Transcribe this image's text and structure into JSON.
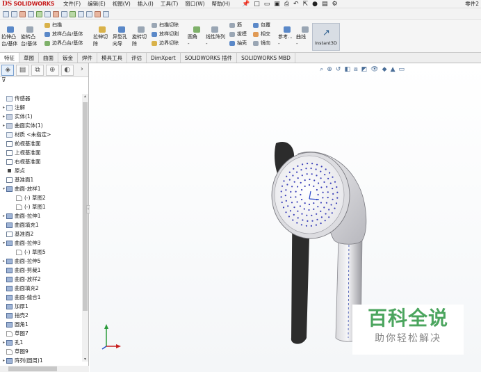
{
  "app": {
    "brand_prefix": "DS",
    "brand": "SOLIDWORKS",
    "document": "零件2"
  },
  "menu": [
    "文件(F)",
    "编辑(E)",
    "视图(V)",
    "插入(I)",
    "工具(T)",
    "窗口(W)",
    "帮助(H)"
  ],
  "ribbon": {
    "row1": [
      {
        "label": "扫描",
        "icon": "sweep-boss-icon"
      },
      {
        "label": "放样凸台/基体",
        "icon": "loft-boss-icon"
      },
      {
        "label": "边界凸台/基体",
        "icon": "boundary-boss-icon"
      },
      {
        "label": "扫描切除",
        "icon": "swept-cut-icon"
      },
      {
        "label": "放样切割",
        "icon": "lofted-cut-icon"
      },
      {
        "label": "边界切除",
        "icon": "boundary-cut-icon"
      },
      {
        "label": "筋",
        "icon": "rib-icon"
      },
      {
        "label": "包覆",
        "icon": "wrap-icon"
      },
      {
        "label": "拔模",
        "icon": "draft-icon"
      },
      {
        "label": "相交",
        "icon": "intersect-icon"
      },
      {
        "label": "抽壳",
        "icon": "shell-icon"
      },
      {
        "label": "镜向",
        "icon": "mirror-icon"
      }
    ],
    "big": [
      {
        "label1": "拉伸凸",
        "label2": "台/基体",
        "icon": "extrude-boss-icon"
      },
      {
        "label1": "旋转凸",
        "label2": "台/基体",
        "icon": "revolve-boss-icon"
      },
      {
        "label1": "拉伸切",
        "label2": "除",
        "icon": "extrude-cut-icon"
      },
      {
        "label1": "异型孔",
        "label2": "向导",
        "icon": "hole-wizard-icon"
      },
      {
        "label1": "旋转切",
        "label2": "除",
        "icon": "revolve-cut-icon"
      },
      {
        "label1": "圆角",
        "label2": "-",
        "icon": "fillet-icon"
      },
      {
        "label1": "线性阵列",
        "label2": "-",
        "icon": "linear-pattern-icon"
      },
      {
        "label1": "参考...",
        "label2": "-",
        "icon": "reference-geometry-icon"
      },
      {
        "label1": "曲线",
        "label2": "-",
        "icon": "curves-icon"
      }
    ],
    "instant3d": "Instant3D"
  },
  "tabs": [
    "特征",
    "草图",
    "曲面",
    "钣金",
    "焊件",
    "模具工具",
    "评估",
    "DimXpert",
    "SOLIDWORKS 插件",
    "SOLIDWORKS MBD"
  ],
  "active_tab": 0,
  "tree": [
    {
      "label": "传感器",
      "icon": "sensor-icon",
      "indent": 0,
      "arrow": ""
    },
    {
      "label": "注解",
      "icon": "annotations-icon",
      "indent": 0,
      "arrow": "▸"
    },
    {
      "label": "实体(1)",
      "icon": "solid-bodies-icon",
      "indent": 0,
      "arrow": "▸"
    },
    {
      "label": "曲面实体(1)",
      "icon": "surface-bodies-icon",
      "indent": 0,
      "arrow": "▸"
    },
    {
      "label": "材质 <未指定>",
      "icon": "material-icon",
      "indent": 0,
      "arrow": ""
    },
    {
      "label": "前视基准面",
      "icon": "plane-icon",
      "indent": 0,
      "arrow": ""
    },
    {
      "label": "上视基准面",
      "icon": "plane-icon",
      "indent": 0,
      "arrow": ""
    },
    {
      "label": "右视基准面",
      "icon": "plane-icon",
      "indent": 0,
      "arrow": ""
    },
    {
      "label": "原点",
      "icon": "origin-icon",
      "indent": 0,
      "arrow": ""
    },
    {
      "label": "基准面1",
      "icon": "plane-icon",
      "indent": 0,
      "arrow": ""
    },
    {
      "label": "曲面-放样1",
      "icon": "surface-loft-icon",
      "indent": 0,
      "arrow": "▾"
    },
    {
      "label": "(-) 草图2",
      "icon": "sketch-icon",
      "indent": 1,
      "arrow": ""
    },
    {
      "label": "(-) 草图1",
      "icon": "sketch-icon",
      "indent": 1,
      "arrow": ""
    },
    {
      "label": "曲面-拉伸1",
      "icon": "surface-extrude-icon",
      "indent": 0,
      "arrow": "▸"
    },
    {
      "label": "曲面填充1",
      "icon": "surface-fill-icon",
      "indent": 0,
      "arrow": ""
    },
    {
      "label": "基准面2",
      "icon": "plane-icon",
      "indent": 0,
      "arrow": ""
    },
    {
      "label": "曲面-拉伸3",
      "icon": "surface-extrude-icon",
      "indent": 0,
      "arrow": "▾"
    },
    {
      "label": "(-) 草图5",
      "icon": "sketch-icon",
      "indent": 1,
      "arrow": ""
    },
    {
      "label": "曲面-拉伸5",
      "icon": "surface-extrude-icon",
      "indent": 0,
      "arrow": "▸"
    },
    {
      "label": "曲面-剪裁1",
      "icon": "surface-trim-icon",
      "indent": 0,
      "arrow": ""
    },
    {
      "label": "曲面-放样2",
      "icon": "surface-loft-icon",
      "indent": 0,
      "arrow": ""
    },
    {
      "label": "曲面填充2",
      "icon": "surface-fill-icon",
      "indent": 0,
      "arrow": ""
    },
    {
      "label": "曲面-缝合1",
      "icon": "surface-knit-icon",
      "indent": 0,
      "arrow": ""
    },
    {
      "label": "加厚1",
      "icon": "thicken-icon",
      "indent": 0,
      "arrow": ""
    },
    {
      "label": "抽壳2",
      "icon": "shell-icon",
      "indent": 0,
      "arrow": ""
    },
    {
      "label": "圆角1",
      "icon": "fillet-icon",
      "indent": 0,
      "arrow": ""
    },
    {
      "label": "草图7",
      "icon": "sketch-icon",
      "indent": 0,
      "arrow": ""
    },
    {
      "label": "孔1",
      "icon": "hole-icon",
      "indent": 0,
      "arrow": "▸"
    },
    {
      "label": "草图9",
      "icon": "sketch-icon",
      "indent": 0,
      "arrow": ""
    },
    {
      "label": "阵列(圆周)1",
      "icon": "circular-pattern-icon",
      "indent": 0,
      "arrow": "▸"
    }
  ],
  "watermark": {
    "title": "百科全说",
    "subtitle": "助你轻松解决"
  }
}
